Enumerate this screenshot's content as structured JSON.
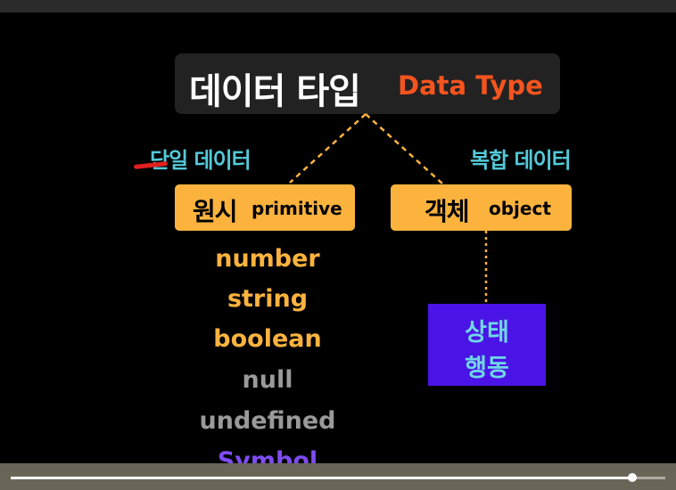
{
  "slide": {
    "title_ko": "데이터 타입",
    "title_en": "Data Type",
    "left_label": "단일 데이터",
    "right_label": "복합 데이터",
    "primitive_box": {
      "ko": "원시",
      "en": "primitive"
    },
    "object_box": {
      "ko": "객체",
      "en": "object"
    },
    "primitive_types": [
      "number",
      "string",
      "boolean",
      "null",
      "undefined",
      "Symbol"
    ],
    "object_contents": [
      "상태",
      "행동"
    ]
  },
  "colors": {
    "title_en": "#f4541f",
    "cyan_label": "#54c9d8",
    "orange_box": "#fbb33e",
    "orange_type": "#fbb33e",
    "gray_type": "#9a9a9a",
    "symbol_purple": "#7e4cf2",
    "object_panel": "#4a14e6"
  },
  "player": {
    "progress": 0.95
  }
}
